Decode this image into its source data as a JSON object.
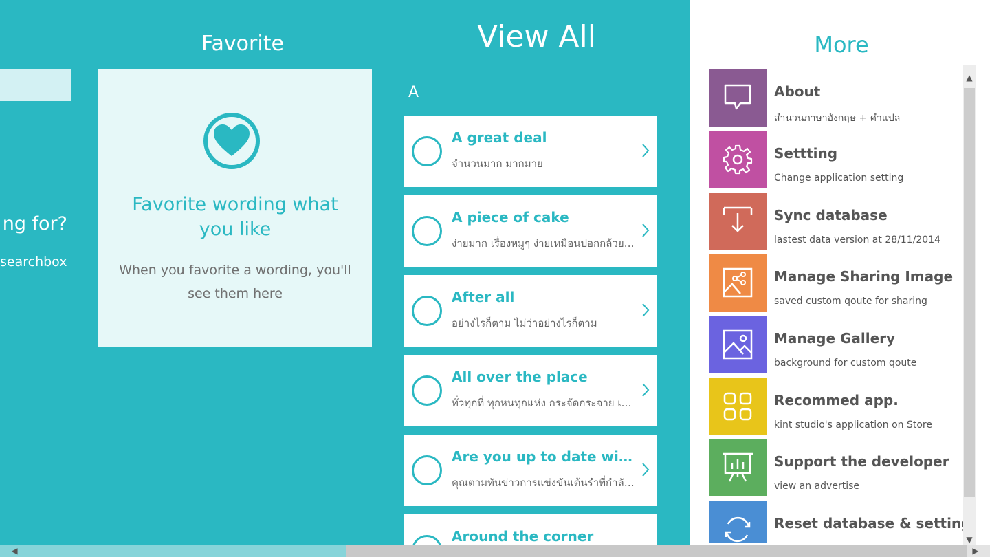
{
  "search": {
    "question": "ng for?",
    "hint": "searchbox"
  },
  "favorite": {
    "title": "Favorite",
    "heading": "Favorite wording what you like",
    "subtext": "When you favorite a wording, you'll see them here",
    "icon": "heart-icon"
  },
  "view_all": {
    "title": "View All",
    "section_letter": "A",
    "items": [
      {
        "word": "A great deal",
        "meaning": "จำนวนมาก มากมาย"
      },
      {
        "word": "A piece of cake",
        "meaning": "ง่ายมาก เรื่องหมูๆ ง่ายเหมือนปอกกล้วยเข้าปาก"
      },
      {
        "word": "After all",
        "meaning": "อย่างไรก็ตาม ไม่ว่าอย่างไรก็ตาม"
      },
      {
        "word": "All over the place",
        "meaning": "ทั่วทุกที่ ทุกหนทุกแห่ง กระจัดกระจาย เละเทะ"
      },
      {
        "word": "Are you up to date with the news",
        "meaning": "คุณตามทันข่าวการแข่งขันเต้นรำที่กำลังจะมีไหม"
      },
      {
        "word": "Around the corner",
        "meaning": ""
      }
    ]
  },
  "more": {
    "title": "More",
    "items": [
      {
        "label": "About",
        "desc": "สำนวนภาษาอังกฤษ + คำแปล",
        "color": "#8a5a92",
        "icon": "speech-bubble-icon"
      },
      {
        "label": "Settting",
        "desc": "Change application setting",
        "color": "#c050a2",
        "icon": "gear-icon"
      },
      {
        "label": "Sync database",
        "desc": "lastest data version at 28/11/2014",
        "color": "#d06a5a",
        "icon": "download-icon"
      },
      {
        "label": "Manage Sharing Image",
        "desc": "saved custom qoute for sharing",
        "color": "#ef8a45",
        "icon": "share-image-icon"
      },
      {
        "label": "Manage Gallery",
        "desc": "background for custom qoute",
        "color": "#6b63e0",
        "icon": "gallery-icon"
      },
      {
        "label": "Recommed app.",
        "desc": "kint studio's application on Store",
        "color": "#e8c51a",
        "icon": "apps-grid-icon"
      },
      {
        "label": "Support the developer",
        "desc": "view an advertise",
        "color": "#5cae5e",
        "icon": "presentation-chart-icon"
      },
      {
        "label": "Reset database & setting",
        "desc": "",
        "color": "#4a8ed4",
        "icon": "refresh-icon"
      }
    ]
  }
}
